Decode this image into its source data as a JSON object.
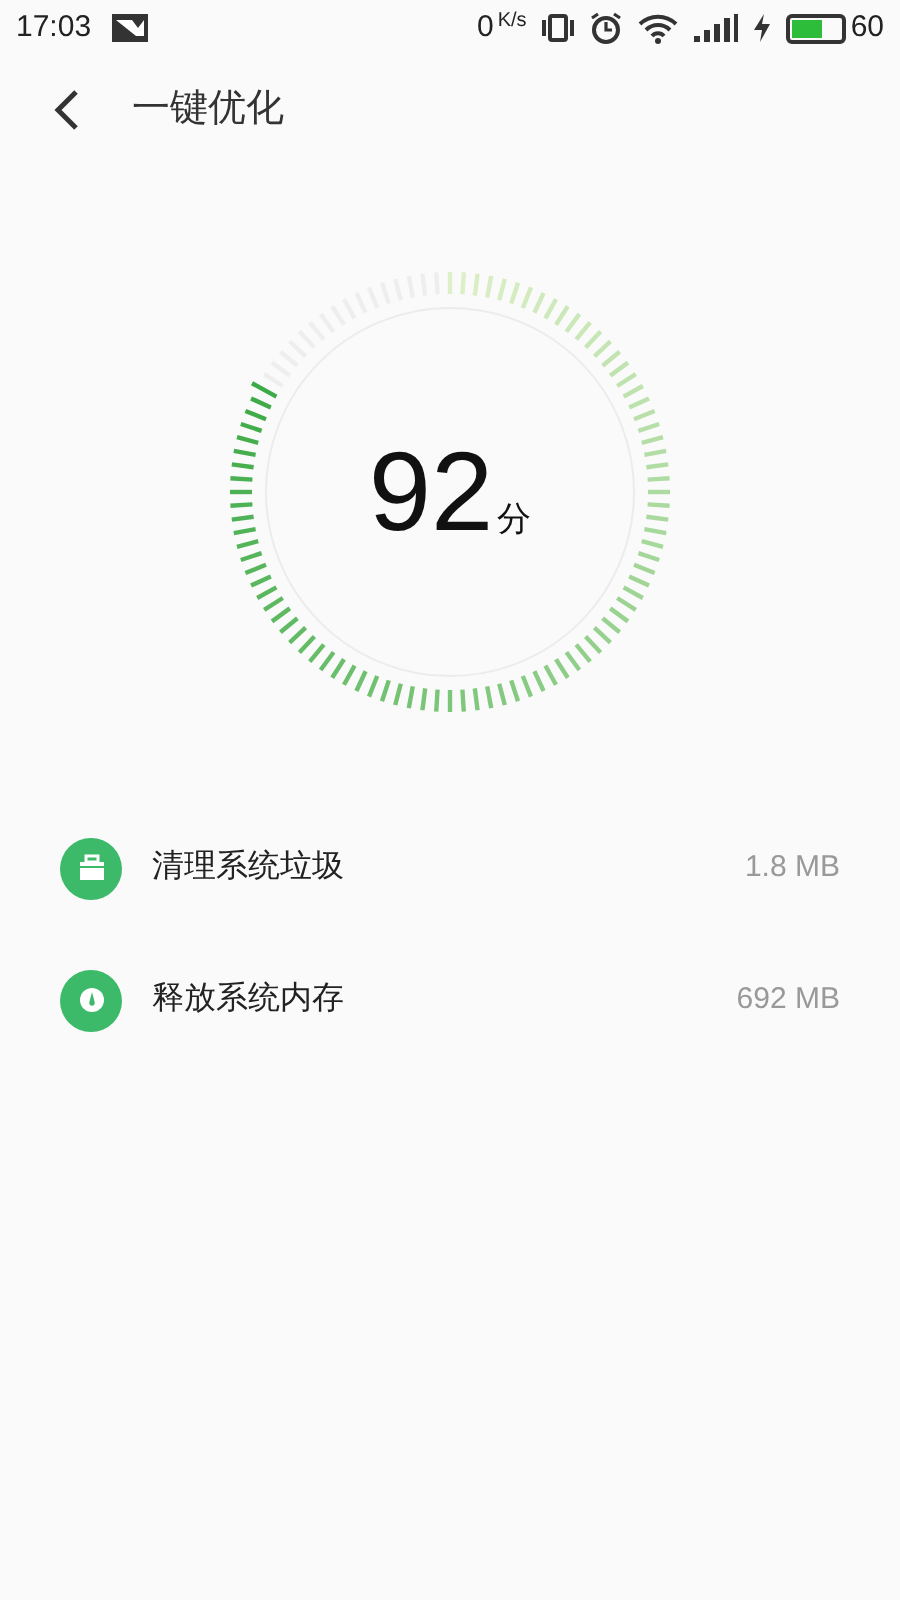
{
  "status_bar": {
    "time": "17:03",
    "speed": "0",
    "speed_unit": "K/s",
    "battery": "60"
  },
  "header": {
    "title": "一键优化"
  },
  "gauge": {
    "score": "92",
    "unit": "分"
  },
  "items": [
    {
      "kind": "trash",
      "label": "清理系统垃圾",
      "value": "1.8 MB"
    },
    {
      "kind": "memory",
      "label": "释放系统内存",
      "value": "692 MB"
    }
  ]
}
